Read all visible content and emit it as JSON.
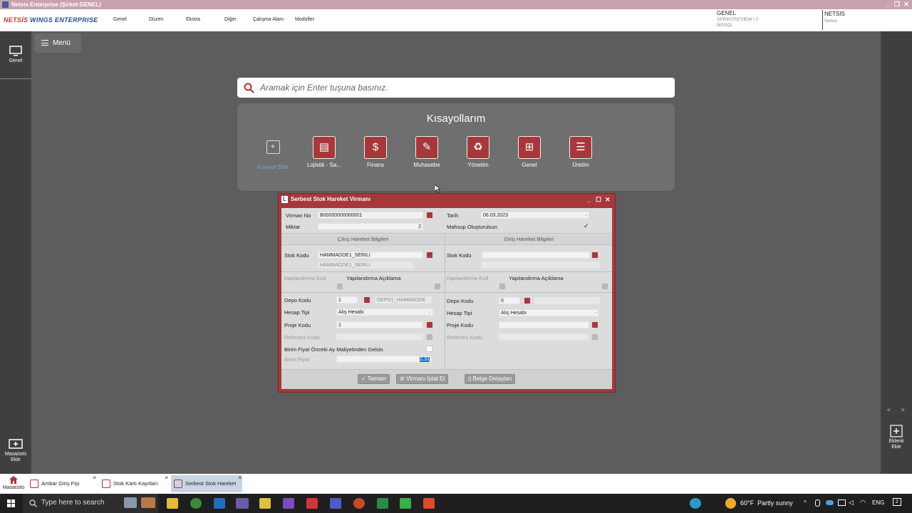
{
  "window": {
    "title": "Netsis Enterprise (Şirket:GENEL)"
  },
  "topbar": {
    "logo_prefix": "NETSİS",
    "logo_suffix": " WINGS ENTERPRISE",
    "menu": [
      "Genel",
      "Düzen",
      "Ekstra",
      "Diğer",
      "Çalışma Alanı",
      "Modüller"
    ],
    "company": "GENEL",
    "server": "SPRINTREVIEW \\ 0",
    "db": "MSSQL",
    "user": "NETSIS",
    "user_sub": "Netsis"
  },
  "leftbar": {
    "top_label": "Genel",
    "bottom_label": "Masaüstü Ekle"
  },
  "rightbar": {
    "nav_prev": "<",
    "nav_next": ">",
    "add_label": "Eklenti Ekle"
  },
  "menu_button": "Menü",
  "search": {
    "placeholder": "Aramak için Enter tuşuna basınız."
  },
  "shortcuts": {
    "title": "Kısayollarım",
    "add_label": "Kısayol Ekle",
    "items": [
      "Lojistik - Sa...",
      "Finans",
      "Muhasebe",
      "Yönetim",
      "Genel",
      "Üretim"
    ]
  },
  "dialog": {
    "title": "Serbest Stok Hareket Virmanı",
    "virman_no_label": "Virman No",
    "virman_no": "B00000000000001",
    "tarih_label": "Tarih",
    "tarih": "06.03.2023",
    "miktar_label": "Miktar",
    "miktar": "2",
    "mahsup_label": "Mahsup Oluşturulsun",
    "mahsup_check": "✓",
    "cikis_header": "Çıkış Hareket Bilgileri",
    "giris_header": "Giriş Hareket Bilgileri",
    "stok_kodu_label": "Stok Kodu",
    "cikis_stok_kodu": "HAMMADDE1_SERILI",
    "cikis_stok_adi": "HAMMADDE1_SERILI",
    "yap_kod_label": "Yapılandırma Kod",
    "yap_aciklama_label": "Yapılandırma Açıklama",
    "depo_kodu_label": "Depo Kodu",
    "cikis_depo_kodu": "1",
    "cikis_depo_adi": "DEPO1_HAMMADDE",
    "giris_depo_kodu": "0",
    "hesap_tipi_label": "Hesap Tipi",
    "hesap_tipi": "Alış Hesabı",
    "giris_hesap_tipi": "Alış Hesabı",
    "proje_kodu_label": "Proje Kodu",
    "cikis_proje_kodu": "1",
    "referans_kodu_label": "Referans Kodu",
    "birim_fiyat_onceki_label": "Birim Fiyat Önceki Ay Maliyetinden Gelsin",
    "birim_fiyat_label": "Birim Fiyat",
    "birim_fiyat": "2.31",
    "btn_tamam": "Tamam",
    "btn_iptal": "Virmanı İptal Et",
    "btn_belge": "Belge Detayları"
  },
  "taskbar_tabs": {
    "home": "Masaüstü",
    "tabs": [
      "Ambar Giriş Fişi",
      "Stok Kartı Kayıtları",
      "Serbest Stok Hareket"
    ]
  },
  "windows_taskbar": {
    "search_placeholder": "Type here to search",
    "weather": "60°F  Partly sunny",
    "lang": "ENG",
    "notif": "2"
  },
  "colors": {
    "accent": "#a6383b",
    "title_bar": "#c8a2ae"
  }
}
